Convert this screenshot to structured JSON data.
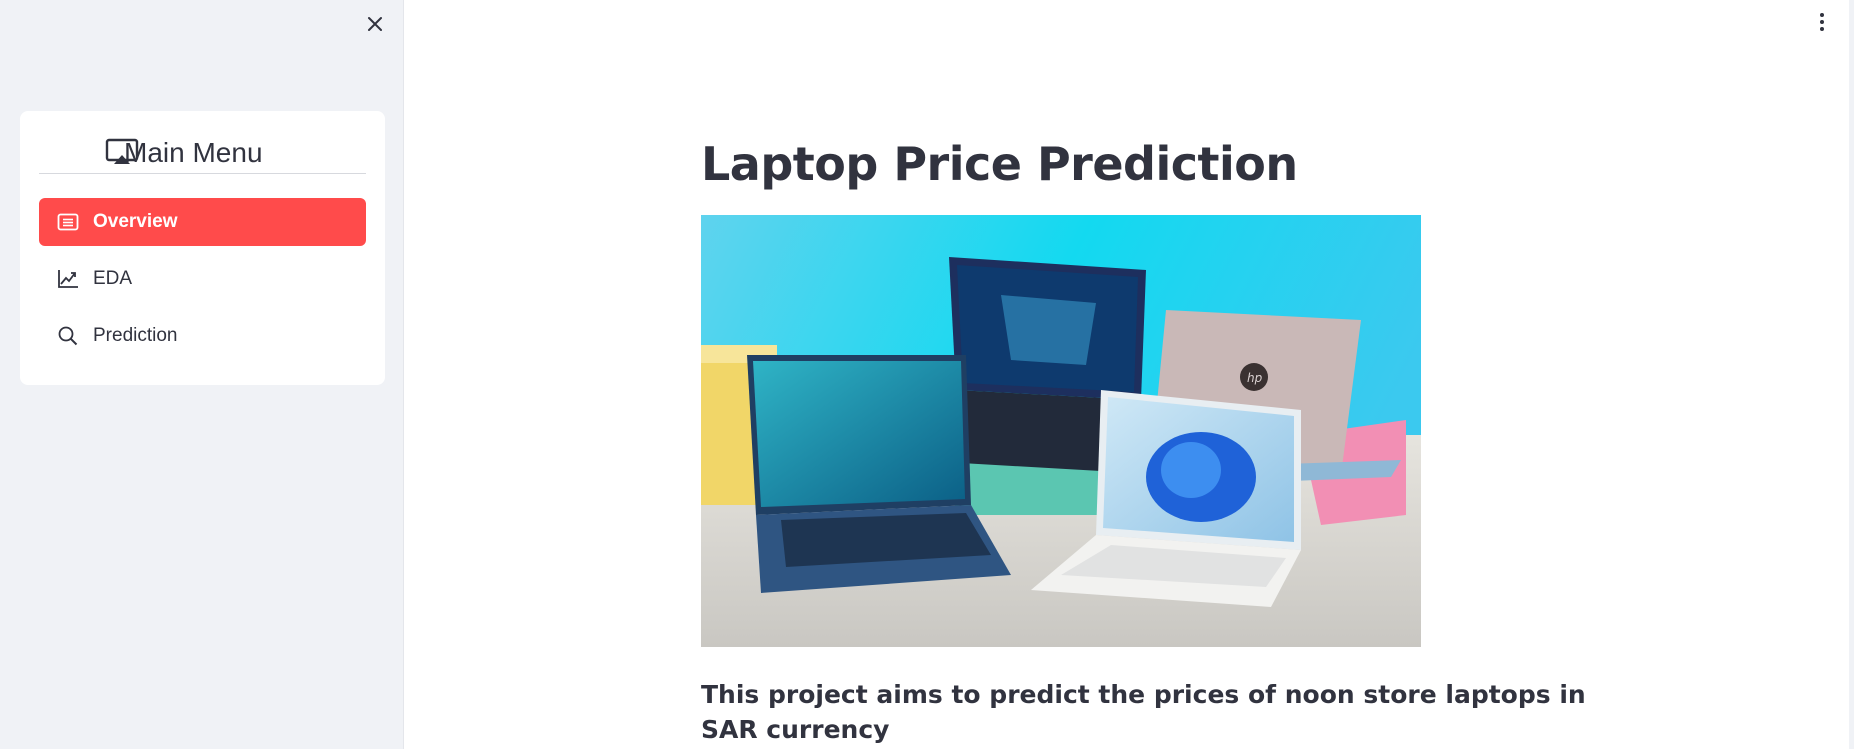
{
  "sidebar": {
    "menu": {
      "title": "Main Menu",
      "icon": "airplay-icon",
      "items": [
        {
          "label": "Overview",
          "icon": "list-icon",
          "active": true
        },
        {
          "label": "EDA",
          "icon": "graph-up-icon",
          "active": false
        },
        {
          "label": "Prediction",
          "icon": "search-icon",
          "active": false
        }
      ]
    }
  },
  "main": {
    "title": "Laptop Price Prediction",
    "description": "This project aims to predict the prices of noon store laptops in SAR currency",
    "image_logo_text": "hp"
  },
  "colors": {
    "accent": "#ff4b4b",
    "sidebar_bg": "#f0f2f6",
    "text": "#31333f"
  }
}
